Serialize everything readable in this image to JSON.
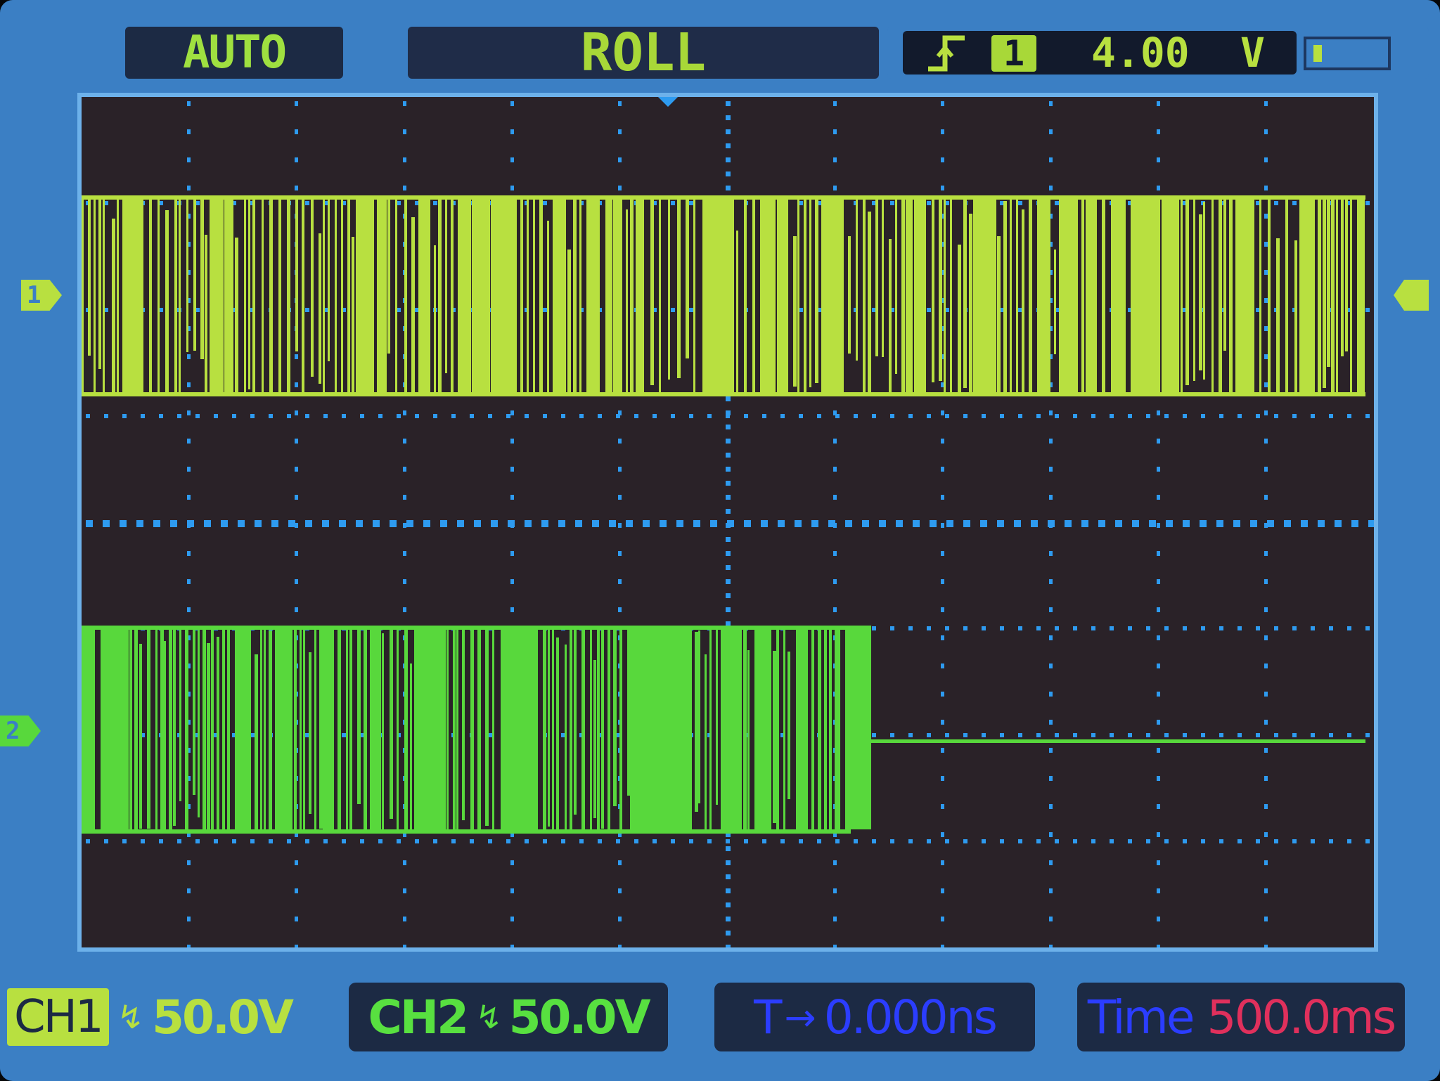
{
  "top_bar": {
    "mode": "AUTO",
    "acquire": "ROLL",
    "trigger": {
      "edge_icon": "rising-edge-icon",
      "source": "1",
      "level": "4.00",
      "unit": "V"
    },
    "memory_fill_fraction": 0.12
  },
  "screen": {
    "ch1_marker": "1",
    "ch2_marker": "2"
  },
  "bottom_bar": {
    "ch1_label": "CH1",
    "ch1_coupling_icon": "ac-coupling-icon",
    "ch1_scale": "50.0V",
    "ch2_label": "CH2",
    "ch2_coupling_icon": "ac-coupling-icon",
    "ch2_scale": "50.0V",
    "trigger_offset_label": "T",
    "trigger_offset_value": "0.000ns",
    "timebase_label": "Time",
    "timebase_value": "500.0ms"
  },
  "colors": {
    "bezel": "#3b7fc4",
    "screen_bg": "#2a2228",
    "grid_dot": "#2e9bf0",
    "ch1": "#b8e040",
    "ch2": "#58d83c",
    "trigger_offset": "#2b3dff",
    "timebase_value": "#e0305c"
  }
}
